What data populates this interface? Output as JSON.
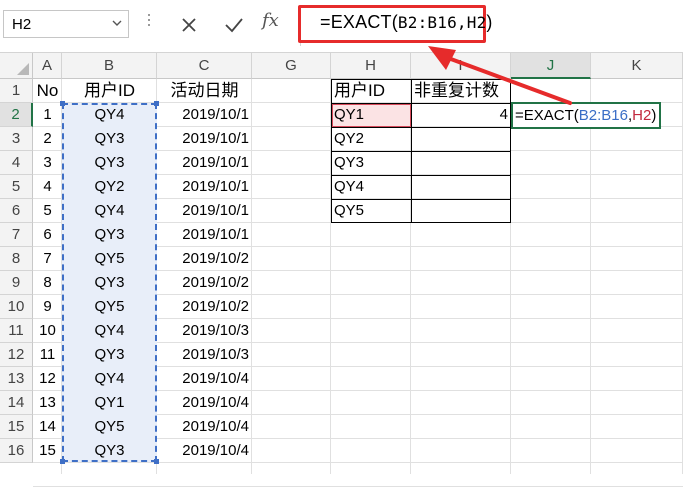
{
  "formula_bar": {
    "name_box": "H2",
    "fx_label": "fx",
    "formula_prefix": "=EXACT(",
    "formula_args": "B2:B16,H2",
    "formula_suffix": ")"
  },
  "columns": [
    "A",
    "B",
    "C",
    "G",
    "H",
    "I",
    "J",
    "K"
  ],
  "rows": [
    "1",
    "2",
    "3",
    "4",
    "5",
    "6",
    "7",
    "8",
    "9",
    "10",
    "11",
    "12",
    "13",
    "14",
    "15",
    "16"
  ],
  "table_left": {
    "headers": [
      "No",
      "用户ID",
      "活动日期"
    ],
    "rows": [
      [
        "1",
        "QY4",
        "2019/10/1"
      ],
      [
        "2",
        "QY3",
        "2019/10/1"
      ],
      [
        "3",
        "QY3",
        "2019/10/1"
      ],
      [
        "4",
        "QY2",
        "2019/10/1"
      ],
      [
        "5",
        "QY4",
        "2019/10/1"
      ],
      [
        "6",
        "QY3",
        "2019/10/1"
      ],
      [
        "7",
        "QY5",
        "2019/10/2"
      ],
      [
        "8",
        "QY3",
        "2019/10/2"
      ],
      [
        "9",
        "QY5",
        "2019/10/2"
      ],
      [
        "10",
        "QY4",
        "2019/10/3"
      ],
      [
        "11",
        "QY3",
        "2019/10/3"
      ],
      [
        "12",
        "QY4",
        "2019/10/4"
      ],
      [
        "13",
        "QY1",
        "2019/10/4"
      ],
      [
        "14",
        "QY5",
        "2019/10/4"
      ],
      [
        "15",
        "QY3",
        "2019/10/4"
      ]
    ]
  },
  "table_right": {
    "headers": [
      "用户ID",
      "非重复计数"
    ],
    "rows": [
      [
        "QY1",
        "4"
      ],
      [
        "QY2",
        ""
      ],
      [
        "QY3",
        ""
      ],
      [
        "QY4",
        ""
      ],
      [
        "QY5",
        ""
      ]
    ]
  },
  "editing_cell": {
    "prefix": "=EXACT(",
    "range": "B2:B16",
    "comma": ",",
    "ref": "H2",
    "suffix": ")"
  },
  "colors": {
    "accent_green": "#217346",
    "highlight_red": "#e62b2b",
    "ref_blue": "#3a6ec6",
    "ref_red": "#c2283d"
  }
}
